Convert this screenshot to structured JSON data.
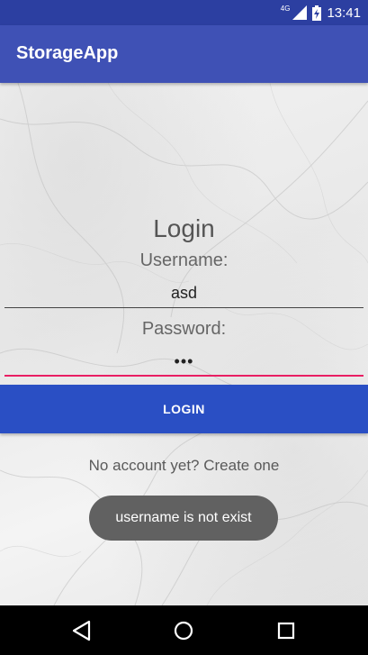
{
  "status_bar": {
    "network": "4G",
    "time": "13:41",
    "icons": [
      "signal-icon",
      "battery-charging-icon"
    ]
  },
  "app_bar": {
    "title": "StorageApp"
  },
  "login": {
    "title": "Login",
    "username_label": "Username:",
    "username_value": "asd",
    "password_label": "Password:",
    "password_value": "•••",
    "button_label": "LOGIN",
    "create_account": "No account yet? Create one"
  },
  "toast": {
    "message": "username is not exist"
  },
  "nav_bar": {
    "icons": [
      "back-icon",
      "home-icon",
      "recents-icon"
    ]
  },
  "colors": {
    "status_bar": "#2c3fa1",
    "app_bar": "#3f51b5",
    "button": "#2a4fc4",
    "accent": "#e91e63",
    "toast": "#616161"
  }
}
